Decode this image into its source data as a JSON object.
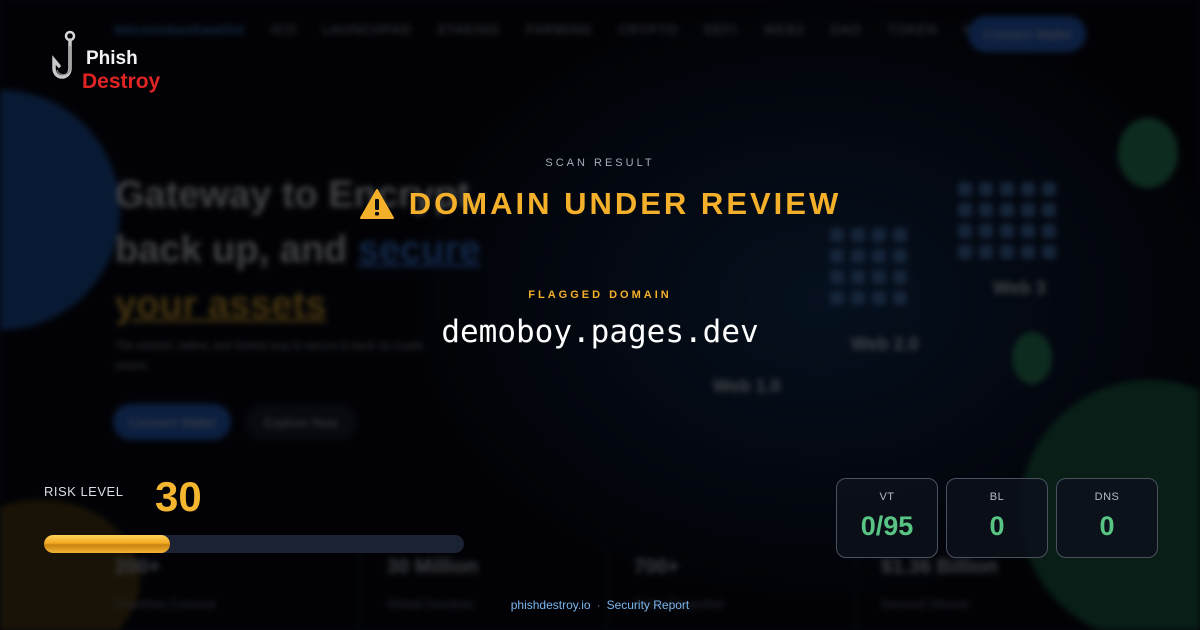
{
  "brand": {
    "line1": "Phish",
    "line2": "Destroy"
  },
  "background_site": {
    "nav_brand": "bitcoinmeshwallet",
    "nav_items": [
      "ICO",
      "LAUNCHPAD",
      "STAKING",
      "FARMING",
      "CRYPTO",
      "DEFI",
      "WEB3",
      "DAO",
      "TOKEN",
      "NFT"
    ],
    "nav_button": "Connect Wallet",
    "hero_line1": "Gateway to Encrypt,",
    "hero_line2a": "back up, and ",
    "hero_line2b": "secure",
    "hero_line3": "your assets",
    "hero_sub": "The easiest, safest, and fastest way to secure & back up crypto assets.",
    "primary_button": "Connect Wallet",
    "secondary_button": "Explore Now",
    "web_labels": [
      "Web 1.0",
      "Web 2.0",
      "Web 3"
    ],
    "stats": [
      {
        "value": "200+",
        "label": "Countries Covered"
      },
      {
        "value": "30 Million",
        "label": "Global Investors"
      },
      {
        "value": "700+",
        "label": "Coins Supported"
      },
      {
        "value": "$1.36 Billion",
        "label": "Secured Volume"
      }
    ]
  },
  "scan": {
    "label": "SCAN RESULT",
    "status_icon": "warning-icon",
    "status_text": "DOMAIN UNDER REVIEW",
    "flagged_label": "FLAGGED DOMAIN",
    "domain": "demoboy.pages.dev"
  },
  "risk": {
    "label": "RISK LEVEL",
    "value": "30",
    "fraction": 0.3
  },
  "cards": [
    {
      "label": "VT",
      "value": "0/95"
    },
    {
      "label": "BL",
      "value": "0"
    },
    {
      "label": "DNS",
      "value": "0"
    }
  ],
  "footer": {
    "site": "phishdestroy.io",
    "separator": "·",
    "text": "Security Report"
  },
  "colors": {
    "accent": "#f4b02a",
    "safe": "#58c585",
    "danger": "#e02424",
    "link": "#79b6ee"
  }
}
